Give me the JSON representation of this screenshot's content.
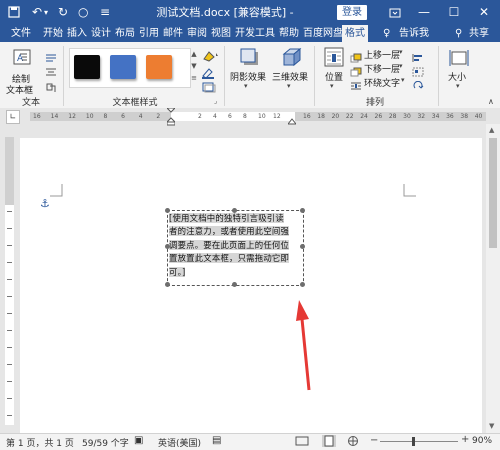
{
  "title": {
    "doc_title": "测试文档.docx [兼容模式] - Word",
    "login_label": "登录"
  },
  "tabs": [
    {
      "label": "文件"
    },
    {
      "label": "开始"
    },
    {
      "label": "插入"
    },
    {
      "label": "设计"
    },
    {
      "label": "布局"
    },
    {
      "label": "引用"
    },
    {
      "label": "邮件"
    },
    {
      "label": "审阅"
    },
    {
      "label": "视图"
    },
    {
      "label": "开发工具"
    },
    {
      "label": "帮助"
    },
    {
      "label": "百度网盘"
    },
    {
      "label": "格式"
    }
  ],
  "tell_me": "告诉我",
  "share": "共享",
  "ribbon": {
    "draw_textbox_line1": "绘制",
    "draw_textbox_line2": "文本框",
    "text_group": "文本",
    "textbox_styles_group": "文本框样式",
    "swatch_colors": [
      "#0a0a0a",
      "#4472c4",
      "#ed7d31"
    ],
    "shadow_effects": "阴影效果",
    "3d_effects": "三维效果",
    "position": "位置",
    "bring_forward": "上移一层",
    "send_backward": "下移一层",
    "wrap_text": "环绕文字",
    "arrange_group": "排列",
    "size": "大小"
  },
  "ruler": {
    "left_ticks": [
      "16",
      "14",
      "12",
      "10",
      "8",
      "6",
      "4",
      "2"
    ],
    "right_ticks": [
      "2",
      "4",
      "6",
      "8",
      "10",
      "12"
    ],
    "far_right_ticks": [
      "16",
      "18",
      "20",
      "22",
      "24",
      "26",
      "28",
      "30",
      "32",
      "34",
      "36",
      "38",
      "40"
    ]
  },
  "textbox": {
    "lines": [
      "[使用文档中的独特引言吸引读",
      "者的注意力，或者使用此空间强",
      "调要点。要在此页面上的任何位",
      "置放置此文本框，只需拖动它即",
      "可。]"
    ]
  },
  "status": {
    "page": "第 1 页，共 1 页",
    "words": "59/59 个字",
    "language": "英语(美国)",
    "zoom": "90%"
  },
  "colors": {
    "accent": "#2b579a",
    "arrow": "#e53935"
  }
}
